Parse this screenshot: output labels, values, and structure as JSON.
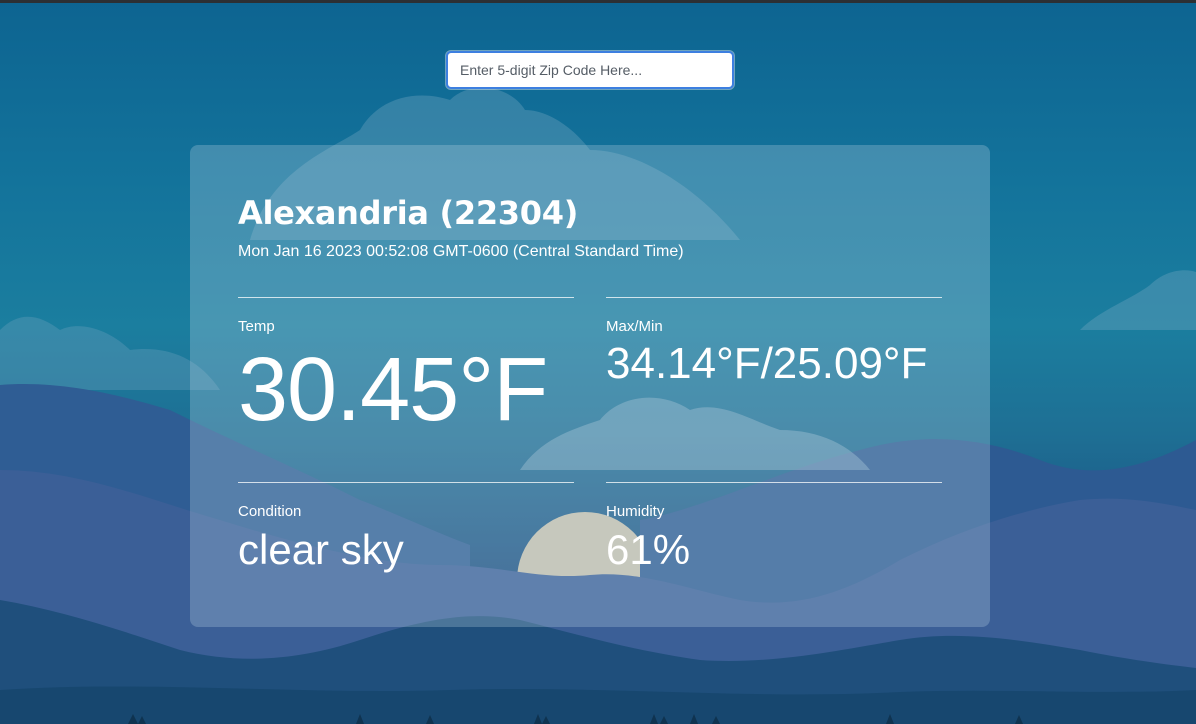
{
  "search": {
    "placeholder": "Enter 5-digit Zip Code Here...",
    "value": ""
  },
  "weather": {
    "location": "Alexandria (22304)",
    "datetime": "Mon Jan 16 2023 00:52:08 GMT-0600 (Central Standard Time)",
    "temp_label": "Temp",
    "temp_value": "30.45°F",
    "maxmin_label": "Max/Min",
    "maxmin_value": "34.14°F/25.09°F",
    "condition_label": "Condition",
    "condition_value": "clear sky",
    "humidity_label": "Humidity",
    "humidity_value": "61%"
  },
  "colors": {
    "sky_top": "#0d6491",
    "sky_mid": "#1b7e9f",
    "mountain_dark": "#1f3f78",
    "mountain_mid": "#3a6aa3",
    "sun": "#c9c3ad",
    "input_border": "#3d7fe0"
  }
}
